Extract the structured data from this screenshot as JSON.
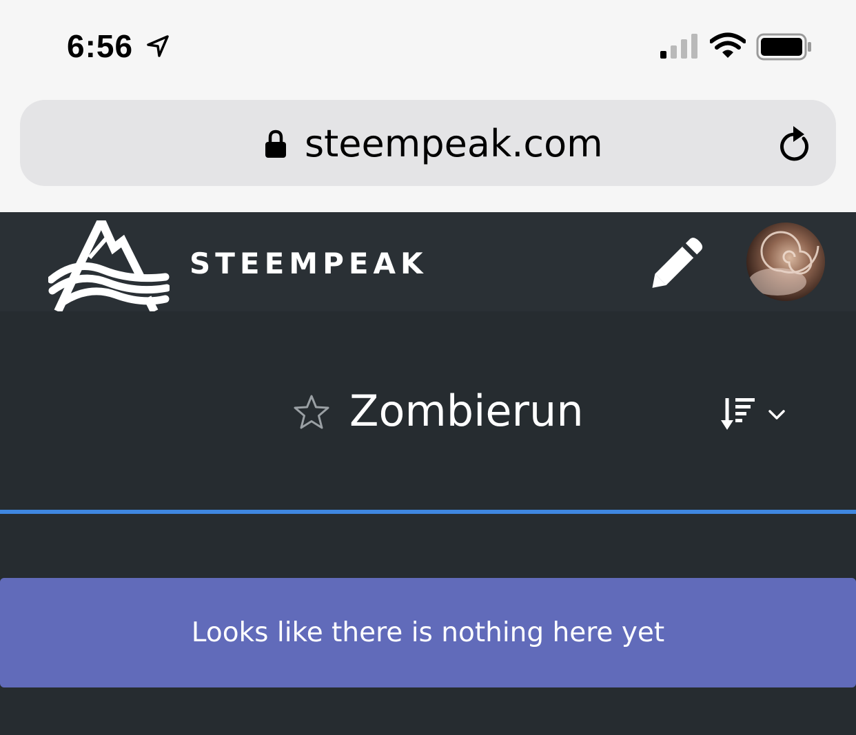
{
  "status_bar": {
    "time": "6:56",
    "icons": [
      "location-arrow-icon",
      "cellular-signal-icon",
      "wifi-icon",
      "battery-icon"
    ]
  },
  "browser": {
    "url": "steempeak.com",
    "icons": [
      "lock-icon",
      "reload-icon"
    ]
  },
  "header": {
    "brand": "STEEMPEAK",
    "icons": [
      "steempeak-logo-icon",
      "pencil-icon"
    ],
    "avatar": "user-avatar"
  },
  "community": {
    "title": "Zombierun",
    "icons": [
      "star-outline-icon",
      "sort-icon",
      "chevron-down-icon"
    ]
  },
  "notice": {
    "message": "Looks like there is nothing here yet"
  },
  "colors": {
    "status_bg": "#f6f6f6",
    "url_field_bg": "#e4e4e6",
    "header_bg": "#2a3035",
    "page_bg": "#262c30",
    "accent_line": "#3f87e0",
    "notice_bg": "#616bba"
  }
}
